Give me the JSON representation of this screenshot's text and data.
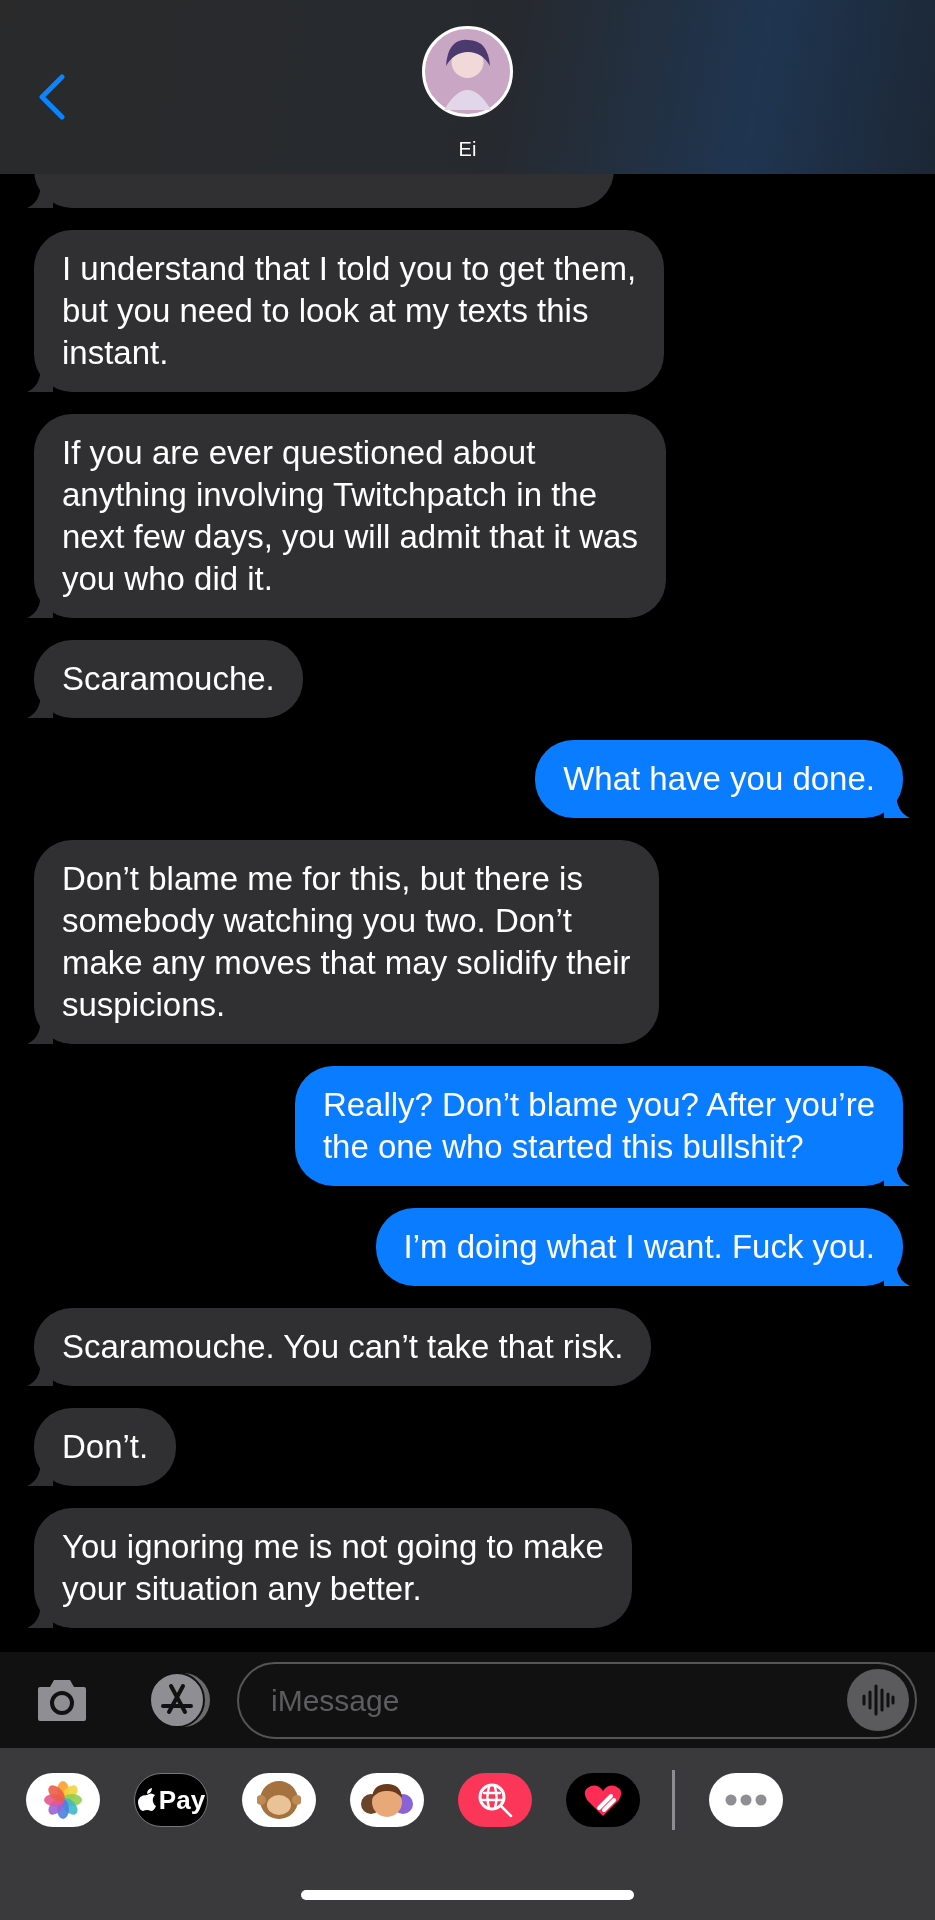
{
  "header": {
    "contact_name": "Ei"
  },
  "messages": [
    {
      "kind": "received"
    },
    {
      "kind": "received",
      "lines": [
        "I understand that I told you to get them,",
        "but you need to look at my texts this",
        "instant."
      ]
    },
    {
      "kind": "received",
      "lines": [
        "If you are ever questioned about",
        "anything involving Twitchpatch in the",
        "next few days, you will admit that it was",
        "you who did it."
      ]
    },
    {
      "kind": "received",
      "lines": [
        "Scaramouche."
      ]
    },
    {
      "kind": "sent",
      "lines": [
        "What have you done."
      ]
    },
    {
      "kind": "received",
      "lines": [
        "Don’t blame me for this, but there is",
        "somebody watching you two. Don’t",
        "make any moves that may solidify their",
        "suspicions."
      ]
    },
    {
      "kind": "sent",
      "lines": [
        "Really? Don’t blame you? After you’re",
        "the one who started this bullshit?"
      ]
    },
    {
      "kind": "sent",
      "lines": [
        "I’m doing what I want. Fuck you."
      ]
    },
    {
      "kind": "received",
      "lines": [
        "Scaramouche. You can’t take that risk."
      ]
    },
    {
      "kind": "received",
      "lines": [
        "Don’t."
      ]
    },
    {
      "kind": "received",
      "lines": [
        "You ignoring me is not going to make",
        "your situation any better."
      ]
    }
  ],
  "composer": {
    "placeholder": "iMessage"
  },
  "app_drawer": {
    "apple_pay_label": "Pay"
  }
}
